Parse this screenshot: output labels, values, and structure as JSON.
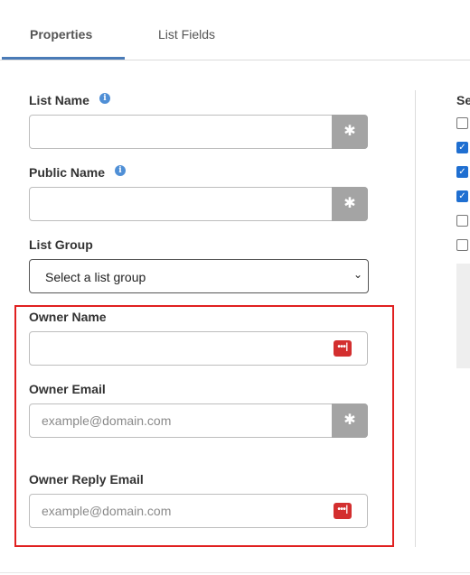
{
  "tabs": [
    {
      "label": "Properties",
      "active": true
    },
    {
      "label": "List Fields",
      "active": false
    }
  ],
  "form": {
    "list_name": {
      "label": "List Name",
      "value": ""
    },
    "public_name": {
      "label": "Public Name",
      "value": ""
    },
    "list_group": {
      "label": "List Group",
      "selected": "Select a list group"
    },
    "owner_name": {
      "label": "Owner Name",
      "value": ""
    },
    "owner_email": {
      "label": "Owner Email",
      "placeholder": "example@domain.com"
    },
    "owner_reply_email": {
      "label": "Owner Reply Email",
      "placeholder": "example@domain.com"
    }
  },
  "right_column": {
    "heading": "Se",
    "checkboxes": [
      false,
      true,
      true,
      true,
      false,
      false
    ]
  },
  "colors": {
    "accent": "#4a7bb7",
    "highlight": "#e02020",
    "checkbox": "#1f6fd1",
    "password_icon": "#d32f2f"
  }
}
